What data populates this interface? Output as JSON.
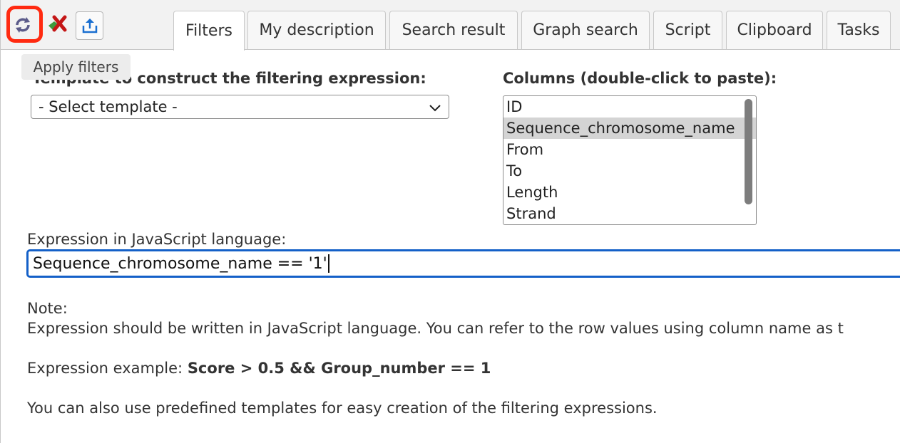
{
  "toolbar": {
    "apply_icon": "refresh-icon",
    "clear_icon": "clear-filter-icon",
    "export_icon": "export-icon",
    "tooltip": "Apply filters"
  },
  "tabs": [
    {
      "label": "Filters",
      "active": true
    },
    {
      "label": "My description",
      "active": false
    },
    {
      "label": "Search result",
      "active": false
    },
    {
      "label": "Graph search",
      "active": false
    },
    {
      "label": "Script",
      "active": false
    },
    {
      "label": "Clipboard",
      "active": false
    },
    {
      "label": "Tasks",
      "active": false
    }
  ],
  "template": {
    "label": "Template to construct the filtering expression:",
    "selected": "- Select template -"
  },
  "columns": {
    "label": "Columns (double-click to paste):",
    "items": [
      "ID",
      "Sequence_chromosome_name",
      "From",
      "To",
      "Length",
      "Strand"
    ],
    "selected_index": 1
  },
  "expression": {
    "label": "Expression in JavaScript language:",
    "value": "Sequence_chromosome_name == '1'"
  },
  "note": {
    "heading": "Note:",
    "text": "Expression should be written in JavaScript language. You can refer to the row values using column name as t",
    "example_prefix": "Expression example: ",
    "example_code": "Score > 0.5 && Group_number == 1",
    "templates_text": "You can also use predefined templates for easy creation of the filtering expressions."
  },
  "colors": {
    "highlight": "#ff2a10",
    "focus": "#1460c8"
  }
}
